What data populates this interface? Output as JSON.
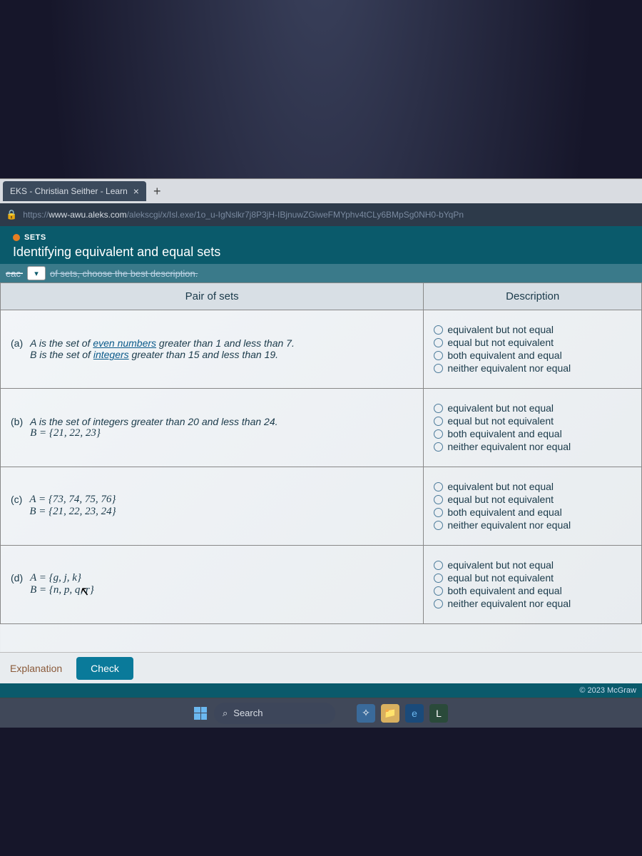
{
  "browser": {
    "tab_title": "EKS - Christian Seither - Learn",
    "url_prefix": "https://",
    "url_domain": "www-awu.aleks.com",
    "url_path": "/alekscgi/x/Isl.exe/1o_u-IgNslkr7j8P3jH-IBjnuwZGiweFMYphv4tCLy6BMpSg0NH0-bYqPn"
  },
  "header": {
    "badge": "SETS",
    "title": "Identifying equivalent and equal sets"
  },
  "instruction": {
    "left_cut": "eac",
    "text": "of sets, choose the best description."
  },
  "table": {
    "col_pair": "Pair of sets",
    "col_desc": "Description",
    "options": [
      "equivalent but not equal",
      "equal but not equivalent",
      "both equivalent and equal",
      "neither equivalent nor equal"
    ],
    "rows": [
      {
        "label": "(a)",
        "line1_pre": "A is the set of ",
        "line1_u": "even numbers",
        "line1_post": " greater than 1 and less than 7.",
        "line2_pre": "B is the set of ",
        "line2_u": "integers",
        "line2_post": " greater than 15 and less than 19."
      },
      {
        "label": "(b)",
        "line1_pre": "A is the set of integers greater than 20 and less than 24.",
        "line1_u": "",
        "line1_post": "",
        "line2_pre": "B = {21, 22, 23}",
        "line2_u": "",
        "line2_post": ""
      },
      {
        "label": "(c)",
        "line1_pre": "A = {73, 74, 75, 76}",
        "line1_u": "",
        "line1_post": "",
        "line2_pre": "B = {21, 22, 23, 24}",
        "line2_u": "",
        "line2_post": ""
      },
      {
        "label": "(d)",
        "line1_pre": "A = {g, j, k}",
        "line1_u": "",
        "line1_post": "",
        "line2_pre": "B = {n, p, q, r}",
        "line2_u": "",
        "line2_post": ""
      }
    ]
  },
  "footer": {
    "explanation": "Explanation",
    "check": "Check",
    "copyright": "© 2023 McGraw"
  },
  "taskbar": {
    "search": "Search"
  }
}
